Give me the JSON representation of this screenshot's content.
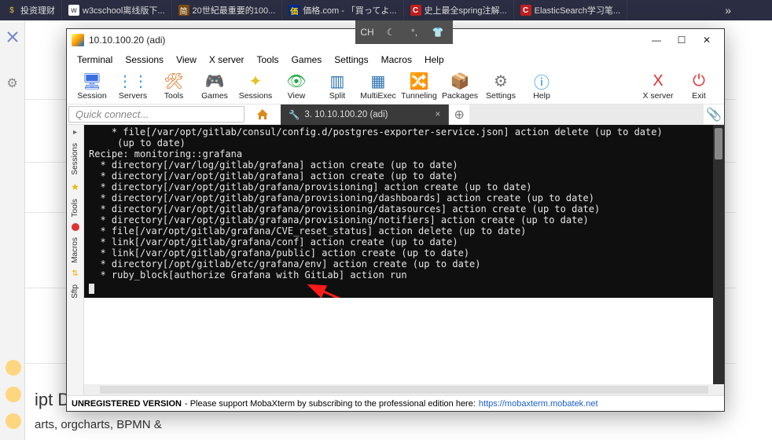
{
  "browser_tabs": [
    {
      "icon": "$",
      "label": "投资理财"
    },
    {
      "icon": "w",
      "label": "w3cschool离线版下..."
    },
    {
      "icon": "S",
      "label": "20世紀最重要的100..."
    },
    {
      "icon": "価",
      "label": "価格.com - 「買ってよ..."
    },
    {
      "icon": "C",
      "label": "史上最全spring注解..."
    },
    {
      "icon": "C",
      "label": "ElasticSearch学习笔..."
    }
  ],
  "ime": {
    "mode": "CH"
  },
  "moba": {
    "title": "10.10.100.20 (adi)",
    "menus": [
      "Terminal",
      "Sessions",
      "View",
      "X server",
      "Tools",
      "Games",
      "Settings",
      "Macros",
      "Help"
    ],
    "toolbar_left": [
      {
        "label": "Session",
        "color": "#3a6fe0"
      },
      {
        "label": "Servers",
        "color": "#39a0e0"
      },
      {
        "label": "Tools",
        "color": "#e06d1a"
      },
      {
        "label": "Games",
        "color": "#a263e0"
      },
      {
        "label": "Sessions",
        "color": "#e6c020"
      },
      {
        "label": "View",
        "color": "#2aa84a"
      },
      {
        "label": "Split",
        "color": "#2a6fb0"
      },
      {
        "label": "MultiExec",
        "color": "#2a6fb0"
      },
      {
        "label": "Tunneling",
        "color": "#2a6fb0"
      },
      {
        "label": "Packages",
        "color": "#b98b2a"
      },
      {
        "label": "Settings",
        "color": "#777"
      },
      {
        "label": "Help",
        "color": "#1f8fe8"
      }
    ],
    "toolbar_right": [
      {
        "label": "X server",
        "color": "#e03030"
      },
      {
        "label": "Exit",
        "color": "#e03030"
      }
    ],
    "quick_connect_placeholder": "Quick connect...",
    "tab_label": "3. 10.10.100.20 (adi)",
    "side": [
      "Sessions",
      "Tools",
      "Macros",
      "Sftp"
    ],
    "status_unreg": "UNREGISTERED VERSION",
    "status_text": " - Please support MobaXterm by subscribing to the professional edition here: ",
    "status_link": "https://mobaxterm.mobatek.net",
    "terminal_lines": [
      "    * file[/var/opt/gitlab/consul/config.d/postgres-exporter-service.json] action delete (up to date)",
      "     (up to date)",
      "Recipe: monitoring::grafana",
      "  * directory[/var/log/gitlab/grafana] action create (up to date)",
      "  * directory[/var/opt/gitlab/grafana] action create (up to date)",
      "  * directory[/var/opt/gitlab/grafana/provisioning] action create (up to date)",
      "  * directory[/var/opt/gitlab/grafana/provisioning/dashboards] action create (up to date)",
      "  * directory[/var/opt/gitlab/grafana/provisioning/datasources] action create (up to date)",
      "  * directory[/var/opt/gitlab/grafana/provisioning/notifiers] action create (up to date)",
      "  * file[/var/opt/gitlab/grafana/CVE_reset_status] action delete (up to date)",
      "  * link[/var/opt/gitlab/grafana/conf] action create (up to date)",
      "  * link[/var/opt/gitlab/grafana/public] action create (up to date)",
      "  * directory[/opt/gitlab/etc/grafana/env] action create (up to date)",
      "  * ruby_block[authorize Grafana with GitLab] action run"
    ]
  },
  "bg": {
    "line1": "ipt Di",
    "line2": "arts, orgcharts, BPMN &"
  }
}
